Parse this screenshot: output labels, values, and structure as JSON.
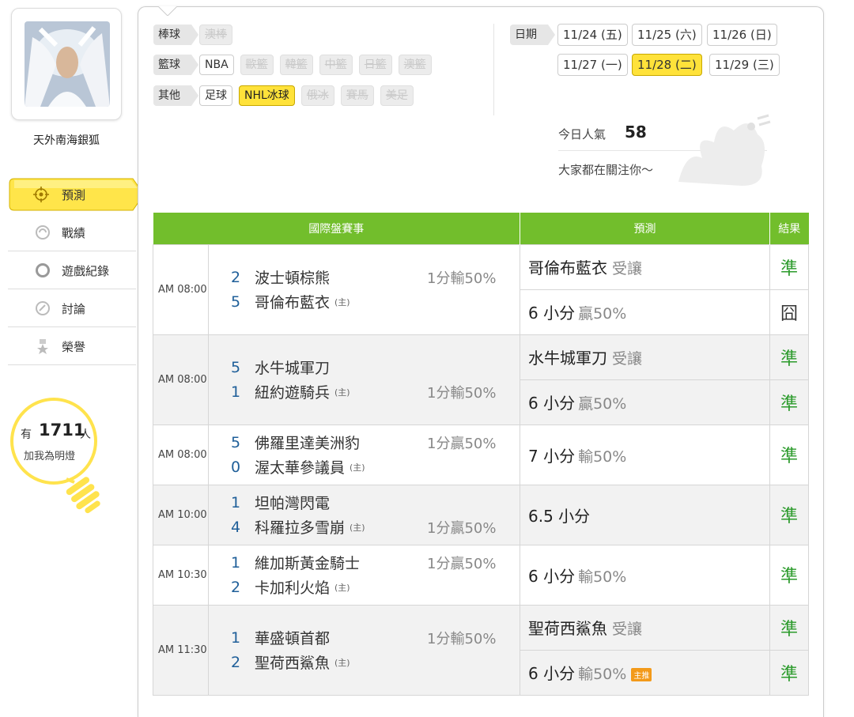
{
  "user": {
    "name": "天外南海銀狐"
  },
  "menu": {
    "items": [
      {
        "label": "預測",
        "icon": "target-icon"
      },
      {
        "label": "戰績",
        "icon": "record-icon"
      },
      {
        "label": "遊戲紀錄",
        "icon": "circle-icon"
      },
      {
        "label": "討論",
        "icon": "discussion-icon"
      },
      {
        "label": "榮譽",
        "icon": "medal-icon"
      }
    ]
  },
  "fans": {
    "prefix": "有",
    "count": "1711",
    "suffix": "人",
    "sub": "加我為明燈"
  },
  "categories": [
    {
      "label": "棒球",
      "tags": [
        {
          "text": "澳棒",
          "state": "disabled"
        }
      ]
    },
    {
      "label": "籃球",
      "tags": [
        {
          "text": "NBA",
          "state": "normal"
        },
        {
          "text": "歐籃",
          "state": "disabled"
        },
        {
          "text": "韓籃",
          "state": "disabled"
        },
        {
          "text": "中籃",
          "state": "disabled"
        },
        {
          "text": "日籃",
          "state": "disabled"
        },
        {
          "text": "澳籃",
          "state": "disabled"
        }
      ]
    },
    {
      "label": "其他",
      "tags": [
        {
          "text": "足球",
          "state": "normal"
        },
        {
          "text": "NHL冰球",
          "state": "selected"
        },
        {
          "text": "俄冰",
          "state": "disabled"
        },
        {
          "text": "賽馬",
          "state": "disabled"
        },
        {
          "text": "美足",
          "state": "disabled"
        }
      ]
    }
  ],
  "dates": {
    "label": "日期",
    "items": [
      "11/24 (五)",
      "11/25 (六)",
      "11/26 (日)",
      "11/27 (一)",
      "11/28 (二)",
      "11/29 (三)"
    ],
    "selected": "11/28 (二)"
  },
  "popularity": {
    "label": "今日人氣",
    "value": "58",
    "sub": "大家都在關注你～"
  },
  "table": {
    "headers": [
      "國際盤賽事",
      "預測",
      "結果"
    ],
    "rows": [
      {
        "time": "AM 08:00",
        "away": {
          "score": "2",
          "name": "波士頓棕熊"
        },
        "home": {
          "score": "5",
          "name": "哥倫布藍衣"
        },
        "home_mark": "(主)",
        "handicap": "1分輸50%",
        "handicap_on": "away",
        "preds": [
          {
            "main": "哥倫布藍衣",
            "note": "受讓",
            "sub": "",
            "result": "準"
          },
          {
            "main": "6 小分",
            "note": "",
            "sub": "贏50%",
            "result": "囧"
          }
        ]
      },
      {
        "time": "AM 08:00",
        "away": {
          "score": "5",
          "name": "水牛城軍刀"
        },
        "home": {
          "score": "1",
          "name": "紐約遊騎兵"
        },
        "home_mark": "(主)",
        "handicap": "1分輸50%",
        "handicap_on": "home",
        "preds": [
          {
            "main": "水牛城軍刀",
            "note": "受讓",
            "sub": "",
            "result": "準"
          },
          {
            "main": "6 小分",
            "note": "",
            "sub": "贏50%",
            "result": "準"
          }
        ]
      },
      {
        "time": "AM 08:00",
        "away": {
          "score": "5",
          "name": "佛羅里達美洲豹"
        },
        "home": {
          "score": "0",
          "name": "渥太華參議員"
        },
        "home_mark": "(主)",
        "handicap": "1分贏50%",
        "handicap_on": "away",
        "preds": [
          {
            "main": "7 小分",
            "note": "",
            "sub": "輸50%",
            "result": "準"
          }
        ]
      },
      {
        "time": "AM 10:00",
        "away": {
          "score": "1",
          "name": "坦帕灣閃電"
        },
        "home": {
          "score": "4",
          "name": "科羅拉多雪崩"
        },
        "home_mark": "(主)",
        "handicap": "1分贏50%",
        "handicap_on": "home",
        "preds": [
          {
            "main": "6.5 小分",
            "note": "",
            "sub": "",
            "result": "準"
          }
        ]
      },
      {
        "time": "AM 10:30",
        "away": {
          "score": "1",
          "name": "維加斯黃金騎士"
        },
        "home": {
          "score": "2",
          "name": "卡加利火焰"
        },
        "home_mark": "(主)",
        "handicap": "1分贏50%",
        "handicap_on": "away",
        "preds": [
          {
            "main": "6 小分",
            "note": "",
            "sub": "輸50%",
            "result": "準"
          }
        ]
      },
      {
        "time": "AM 11:30",
        "away": {
          "score": "1",
          "name": "華盛頓首都"
        },
        "home": {
          "score": "2",
          "name": "聖荷西鯊魚"
        },
        "home_mark": "(主)",
        "handicap": "1分輸50%",
        "handicap_on": "away",
        "preds": [
          {
            "main": "聖荷西鯊魚",
            "note": "受讓",
            "sub": "",
            "result": "準"
          },
          {
            "main": "6 小分",
            "note": "",
            "sub": "輸50%",
            "badge": "主推",
            "result": "準"
          }
        ]
      }
    ]
  }
}
